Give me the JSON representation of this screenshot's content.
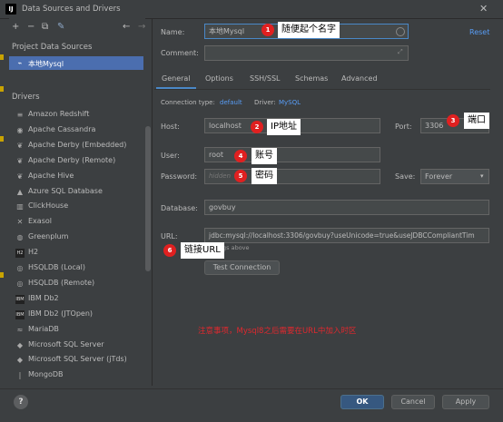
{
  "window": {
    "title": "Data Sources and Drivers",
    "app_icon": "IJ"
  },
  "toolbar": {
    "add": "+",
    "remove": "−",
    "duplicate": "⧉",
    "edit": "✎",
    "back": "←",
    "forward": "→"
  },
  "project_sources": {
    "header": "Project Data Sources",
    "items": [
      {
        "label": "本地Mysql"
      }
    ]
  },
  "drivers": {
    "header": "Drivers",
    "items": [
      {
        "label": "Amazon Redshift",
        "icon": "≡"
      },
      {
        "label": "Apache Cassandra",
        "icon": "◉"
      },
      {
        "label": "Apache Derby (Embedded)",
        "icon": "❦"
      },
      {
        "label": "Apache Derby (Remote)",
        "icon": "❦"
      },
      {
        "label": "Apache Hive",
        "icon": "❦"
      },
      {
        "label": "Azure SQL Database",
        "icon": "▲"
      },
      {
        "label": "ClickHouse",
        "icon": "▥"
      },
      {
        "label": "Exasol",
        "icon": "✕"
      },
      {
        "label": "Greenplum",
        "icon": "◍"
      },
      {
        "label": "H2",
        "icon": "H2"
      },
      {
        "label": "HSQLDB (Local)",
        "icon": "◎"
      },
      {
        "label": "HSQLDB (Remote)",
        "icon": "◎"
      },
      {
        "label": "IBM Db2",
        "icon": "IBM"
      },
      {
        "label": "IBM Db2 (JTOpen)",
        "icon": "IBM"
      },
      {
        "label": "MariaDB",
        "icon": "≈"
      },
      {
        "label": "Microsoft SQL Server",
        "icon": "◆"
      },
      {
        "label": "Microsoft SQL Server (jTds)",
        "icon": "◆"
      },
      {
        "label": "MongoDB",
        "icon": "❘"
      }
    ]
  },
  "form": {
    "name_label": "Name:",
    "name_value": "本地Mysql",
    "reset_label": "Reset",
    "comment_label": "Comment:",
    "comment_value": "",
    "tabs": [
      "General",
      "Options",
      "SSH/SSL",
      "Schemas",
      "Advanced"
    ],
    "connection_type_label": "Connection type:",
    "connection_type_value": "default",
    "driver_label": "Driver:",
    "driver_value": "MySQL",
    "host_label": "Host:",
    "host_value": "localhost",
    "port_label": "Port:",
    "port_value": "3306",
    "user_label": "User:",
    "user_value": "root",
    "password_label": "Password:",
    "password_value": "hidden",
    "save_label": "Save:",
    "save_value": "Forever",
    "database_label": "Database:",
    "database_value": "govbuy",
    "url_label": "URL:",
    "url_value": "jdbc:mysql://localhost:3306/govbuy?useUnicode=true&useJDBCCompliantTim",
    "url_hint": "ettings above",
    "test_button": "Test Connection"
  },
  "annotations": {
    "callouts": [
      {
        "num": "1",
        "text": "随便起个名字"
      },
      {
        "num": "2",
        "text": "IP地址"
      },
      {
        "num": "3",
        "text": "端口"
      },
      {
        "num": "4",
        "text": "账号"
      },
      {
        "num": "5",
        "text": "密码"
      },
      {
        "num": "6",
        "text": "链接URL"
      }
    ],
    "notice": "注意事项，Mysql8之后需要在URL中加入时区"
  },
  "footer": {
    "help": "?",
    "ok": "OK",
    "cancel": "Cancel",
    "apply": "Apply"
  },
  "colors": {
    "accent": "#4a88c7",
    "selection": "#4b6eaf",
    "badge": "#e02020",
    "notice": "#e0282e"
  }
}
